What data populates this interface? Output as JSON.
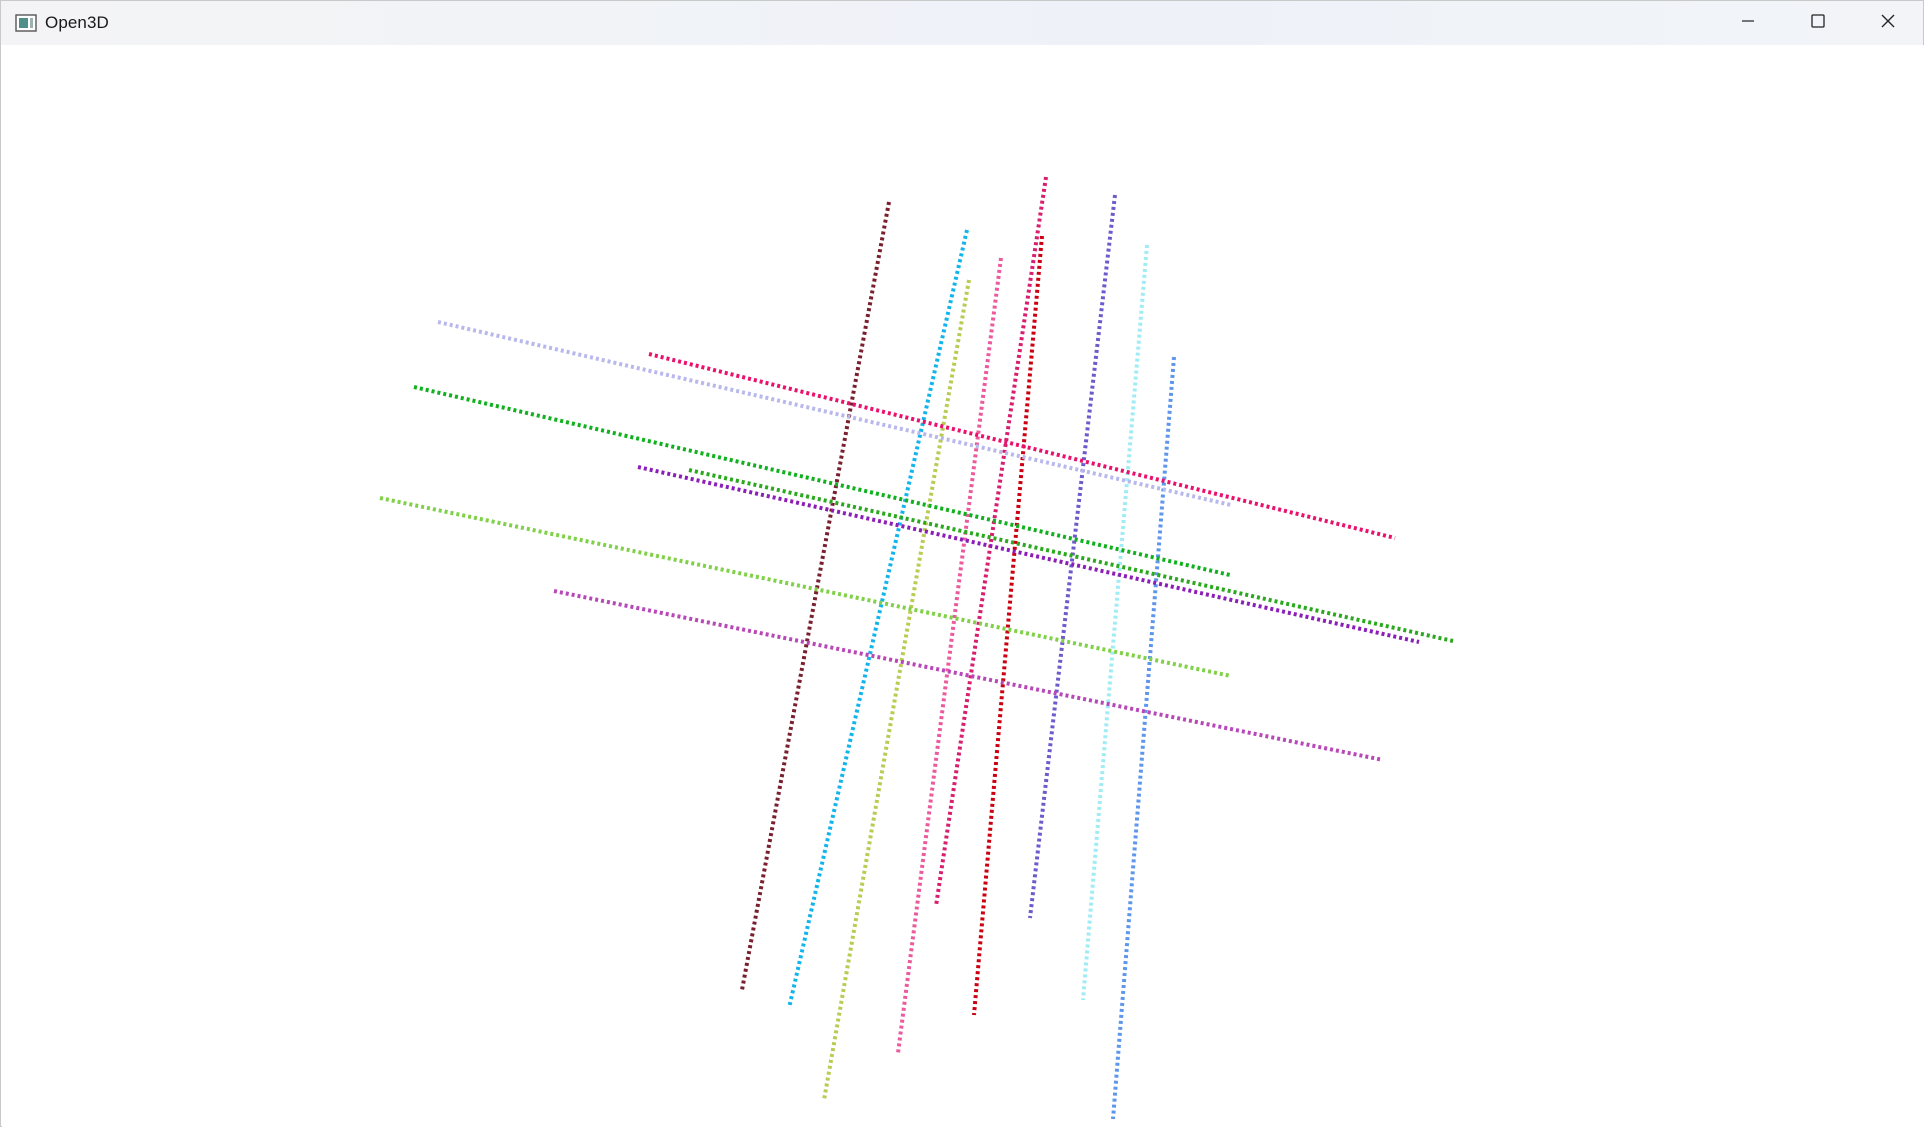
{
  "window": {
    "title": "Open3D",
    "icons": {
      "app": "open3d-app-icon",
      "minimize": "minimize-icon",
      "maximize": "maximize-icon",
      "close": "close-icon"
    }
  },
  "scene": {
    "background": "#ffffff",
    "line_style": "dotted",
    "lines": [
      {
        "name": "maroon-line",
        "color": "#7a1f2e"
      },
      {
        "name": "deep-sky-blue-line",
        "color": "#12b4ec"
      },
      {
        "name": "yellow-green-line",
        "color": "#b8cc52"
      },
      {
        "name": "hot-pink-line",
        "color": "#ec5a9e"
      },
      {
        "name": "crimson-line",
        "color": "#d81e6e"
      },
      {
        "name": "red-line",
        "color": "#cc0010"
      },
      {
        "name": "slate-blue-line",
        "color": "#6e5acc"
      },
      {
        "name": "pale-cyan-line",
        "color": "#a0ecf4"
      },
      {
        "name": "cornflower-blue-line",
        "color": "#5e96ec"
      },
      {
        "name": "lavender-line",
        "color": "#b8b8ec"
      },
      {
        "name": "magenta-pink-line",
        "color": "#e8126e"
      },
      {
        "name": "green-line",
        "color": "#10b01e"
      },
      {
        "name": "purple-line",
        "color": "#8c1eb8"
      },
      {
        "name": "forest-green-line",
        "color": "#2aa81e"
      },
      {
        "name": "light-green-line",
        "color": "#80d048"
      },
      {
        "name": "orchid-line",
        "color": "#b848b8"
      }
    ]
  }
}
